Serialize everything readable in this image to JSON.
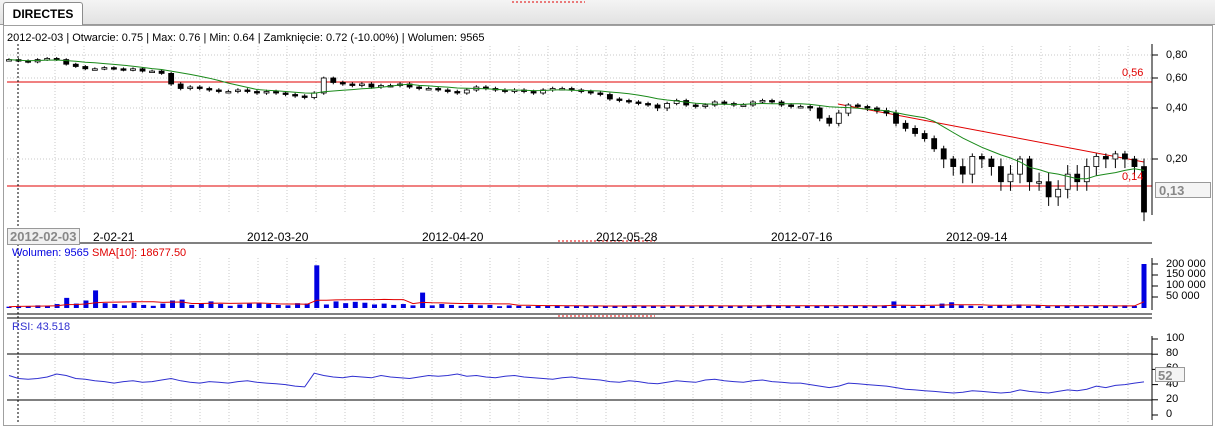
{
  "tab": {
    "label": "DIRECTES"
  },
  "header": {
    "info": "2012-02-03 | Otwarcie: 0.75 | Max: 0.76 | Min: 0.64 | Zamknięcie: 0.72 (-10.00%) | Wolumen: 9565"
  },
  "price_panel": {
    "y_ticks": [
      "0,80",
      "0,60",
      "0,40",
      "0,20"
    ],
    "resistance_label": "0,56",
    "support_label": "0,14",
    "last_price_box": "0,13",
    "colors": {
      "sma": "#1a8a1a",
      "lines": "#e00000",
      "candle": "#000000"
    }
  },
  "x_axis": {
    "cursor_date": "2012-02-03",
    "labels": [
      "2-02-21",
      "2012-03-20",
      "2012-04-20",
      "2012-05-28",
      "2012-07-16",
      "2012-09-14"
    ]
  },
  "volume_panel": {
    "legend_volume": "Wolumen: 9565",
    "legend_sma": "SMA[10]: 18677.50",
    "y_ticks": [
      "200 000",
      "150 000",
      "100 000",
      "50 000"
    ],
    "colors": {
      "bars": "#0000e0",
      "sma": "#e00000"
    }
  },
  "rsi_panel": {
    "legend": "RSI: 43.518",
    "y_ticks": [
      "100",
      "80",
      "60",
      "40",
      "20",
      "0"
    ],
    "last_box": "52",
    "color": "#3030d0"
  },
  "chart_data": [
    {
      "type": "candlestick",
      "title": "2012-02-03 | Otwarcie: 0.75 | Max: 0.76 | Min: 0.64 | Zamknięcie: 0.72 (-10.00%) | Wolumen: 9565",
      "ylim": [
        0.13,
        0.83
      ],
      "yticks": [
        0.8,
        0.6,
        0.4,
        0.2
      ],
      "horizontal_lines": [
        0.56,
        0.14
      ],
      "trendline": {
        "from": [
          "2012-07-20",
          0.42
        ],
        "to": [
          "2012-10-30",
          0.19
        ]
      },
      "x_tick_labels": [
        "2-02-21",
        "2012-03-20",
        "2012-04-20",
        "2012-05-28",
        "2012-07-16",
        "2012-09-14"
      ],
      "close_approx": [
        0.76,
        0.75,
        0.74,
        0.76,
        0.77,
        0.76,
        0.72,
        0.7,
        0.68,
        0.68,
        0.69,
        0.68,
        0.67,
        0.68,
        0.66,
        0.66,
        0.64,
        0.56,
        0.53,
        0.54,
        0.53,
        0.52,
        0.51,
        0.51,
        0.52,
        0.51,
        0.5,
        0.51,
        0.5,
        0.49,
        0.48,
        0.47,
        0.5,
        0.6,
        0.57,
        0.56,
        0.55,
        0.56,
        0.54,
        0.55,
        0.55,
        0.56,
        0.54,
        0.53,
        0.53,
        0.52,
        0.51,
        0.5,
        0.52,
        0.54,
        0.53,
        0.52,
        0.51,
        0.52,
        0.51,
        0.5,
        0.52,
        0.53,
        0.53,
        0.52,
        0.51,
        0.5,
        0.49,
        0.46,
        0.45,
        0.44,
        0.43,
        0.42,
        0.4,
        0.43,
        0.45,
        0.42,
        0.41,
        0.42,
        0.44,
        0.43,
        0.42,
        0.42,
        0.44,
        0.45,
        0.44,
        0.42,
        0.41,
        0.41,
        0.4,
        0.36,
        0.34,
        0.38,
        0.42,
        0.41,
        0.4,
        0.39,
        0.38,
        0.34,
        0.32,
        0.3,
        0.28,
        0.24,
        0.2,
        0.19,
        0.18,
        0.21,
        0.2,
        0.19,
        0.17,
        0.18,
        0.2,
        0.17,
        0.17,
        0.15,
        0.16,
        0.18,
        0.17,
        0.19,
        0.21,
        0.2,
        0.22,
        0.2,
        0.19,
        0.13
      ]
    },
    {
      "type": "bar",
      "title": "Wolumen: 9565",
      "ylim": [
        0,
        210000
      ],
      "yticks": [
        200000,
        150000,
        100000,
        50000
      ],
      "series": [
        {
          "name": "Wolumen",
          "values_approx": [
            6000,
            9000,
            8000,
            12000,
            10000,
            18000,
            46000,
            20000,
            34000,
            80000,
            22000,
            18000,
            12000,
            24000,
            14000,
            10000,
            20000,
            34000,
            38000,
            14000,
            22000,
            30000,
            18000,
            10000,
            16000,
            20000,
            24000,
            18000,
            14000,
            12000,
            22000,
            20000,
            194000,
            16000,
            30000,
            22000,
            28000,
            24000,
            16000,
            20000,
            14000,
            18000,
            12000,
            70000,
            12000,
            18000,
            14000,
            10000,
            16000,
            12000,
            14000,
            8000,
            12000,
            10000,
            8000,
            9000,
            10000,
            12000,
            8000,
            9000,
            10000,
            8000,
            9000,
            8000,
            10000,
            12000,
            9000,
            11000,
            8000,
            10000,
            9000,
            8000,
            12000,
            9000,
            8000,
            10000,
            9000,
            12000,
            10000,
            14000,
            12000,
            10000,
            8000,
            10000,
            9000,
            12000,
            8000,
            10000,
            11000,
            9000,
            10000,
            12000,
            30000,
            10000,
            8000,
            12000,
            9000,
            20000,
            26000,
            12000,
            10000,
            8000,
            9000,
            12000,
            10000,
            16000,
            9000,
            11000,
            8000,
            10000,
            12000,
            9000,
            8000,
            10000,
            9000,
            8000,
            12000,
            9565,
            200000
          ]
        },
        {
          "name": "SMA[10]",
          "value": 18677.5
        }
      ]
    },
    {
      "type": "line",
      "title": "RSI: 43.518",
      "ylim": [
        0,
        100
      ],
      "yticks": [
        100,
        80,
        60,
        40,
        20,
        0
      ],
      "series": [
        {
          "name": "RSI",
          "values_approx": [
            52,
            48,
            47,
            48,
            50,
            54,
            52,
            48,
            47,
            45,
            44,
            42,
            44,
            45,
            43,
            44,
            46,
            48,
            45,
            43,
            42,
            44,
            43,
            42,
            44,
            45,
            43,
            42,
            41,
            40,
            38,
            37,
            55,
            52,
            50,
            49,
            51,
            50,
            49,
            52,
            50,
            49,
            48,
            50,
            52,
            51,
            52,
            54,
            51,
            52,
            50,
            49,
            51,
            52,
            50,
            49,
            48,
            47,
            49,
            50,
            48,
            47,
            46,
            44,
            43,
            45,
            44,
            42,
            41,
            43,
            45,
            44,
            43,
            46,
            47,
            45,
            44,
            43,
            45,
            46,
            44,
            43,
            42,
            42,
            40,
            38,
            36,
            38,
            42,
            41,
            40,
            39,
            38,
            36,
            34,
            33,
            32,
            31,
            30,
            29,
            30,
            32,
            31,
            30,
            29,
            30,
            33,
            31,
            30,
            29,
            31,
            33,
            32,
            34,
            38,
            36,
            39,
            40,
            42,
            43.5
          ]
        }
      ]
    }
  ]
}
